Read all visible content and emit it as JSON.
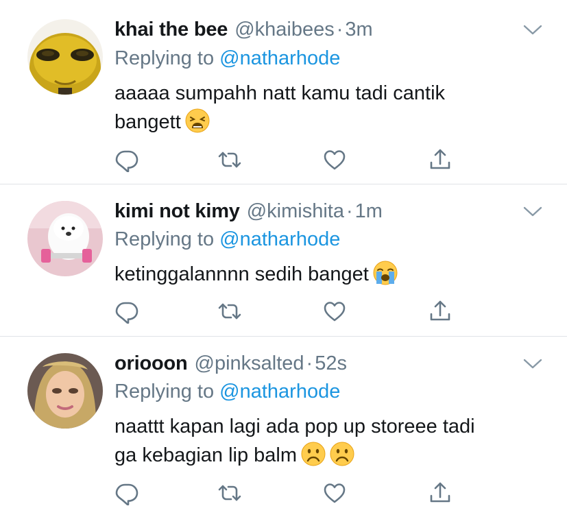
{
  "tweets": [
    {
      "name": "khai the bee",
      "handle": "@khaibees",
      "separator": "·",
      "time": "3m",
      "replying_prefix": "Replying to",
      "replying_to": "@natharhode",
      "text_line1": "aaaaa sumpahh natt kamu tadi cantik",
      "text_line2": "bangett",
      "emojis": [
        "weary-face"
      ],
      "avatar": "yellow-bee-character-avatar"
    },
    {
      "name": "kimi not kimy",
      "handle": "@kimishita",
      "separator": "·",
      "time": "1m",
      "replying_prefix": "Replying to",
      "replying_to": "@natharhode",
      "text_line1": "ketinggalannnn sedih banget",
      "emojis": [
        "loudly-crying-face"
      ],
      "avatar": "white-fluffy-dog-with-dumbbell-avatar"
    },
    {
      "name": "oriooon",
      "handle": "@pinksalted",
      "separator": "·",
      "time": "52s",
      "replying_prefix": "Replying to",
      "replying_to": "@natharhode",
      "text_line1": "naattt kapan lagi ada pop up storeee tadi",
      "text_line2": "ga kebagian lip balm",
      "emojis": [
        "frowning-face",
        "frowning-face"
      ],
      "avatar": "doll-girl-avatar"
    }
  ],
  "icons": {
    "reply": "reply-icon",
    "retweet": "retweet-icon",
    "like": "like-icon",
    "share": "share-icon",
    "more": "chevron-down-icon"
  },
  "colors": {
    "mention": "#1b95e0",
    "muted": "#657786",
    "text": "#14171a",
    "divider": "#dfe3e7"
  }
}
